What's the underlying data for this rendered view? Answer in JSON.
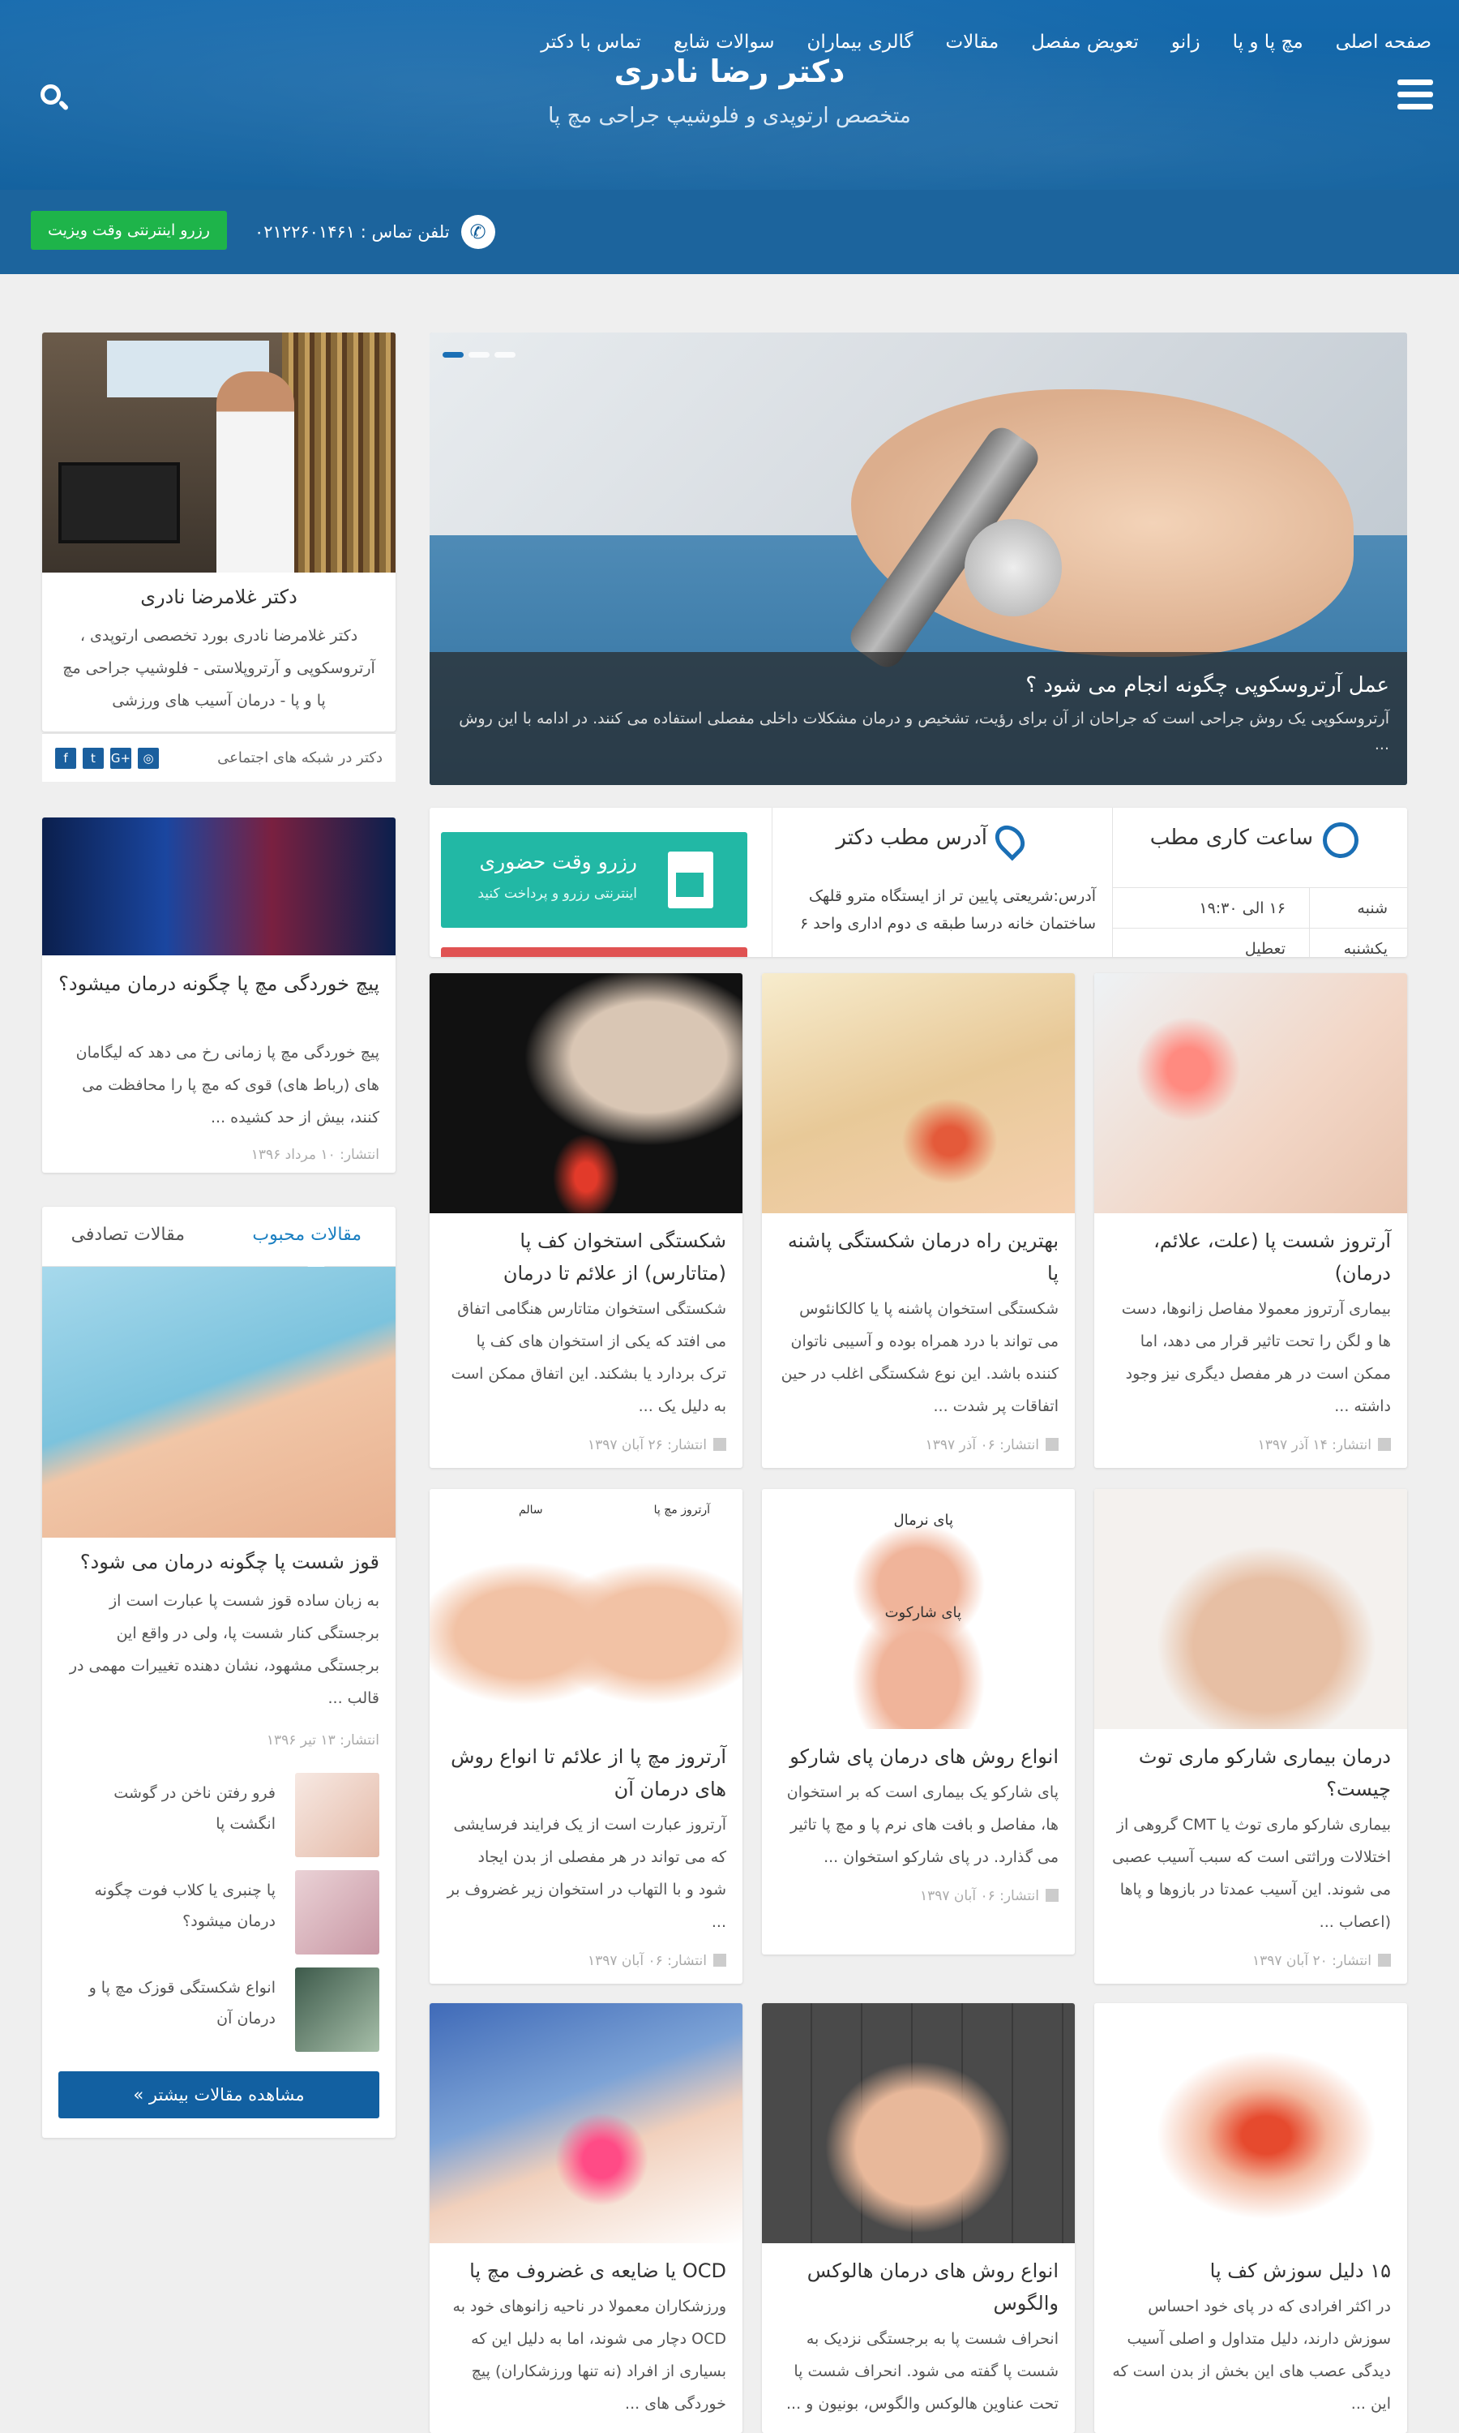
{
  "header": {
    "title": "دکتر رضا نادری",
    "subtitle": "متخصص ارتوپدی و فلوشیپ جراحی مچ پا"
  },
  "nav": {
    "items": [
      "صفحه اصلی",
      "مچ پا و پا",
      "زانو",
      "تعویض مفصل",
      "مقالات",
      "گالری بیماران",
      "سوالات شایع",
      "تماس با دکتر"
    ],
    "phone": "تلفن تماس : ۰۲۱۲۲۶۰۱۴۶۱",
    "book_button": "رزرو اینترنتی وقت ویزیت"
  },
  "slider": {
    "title": "عمل آرتروسکوپی چگونه انجام می شود ؟",
    "text": "آرتروسکوپی یک روش جراحی است که جراحان از آن برای رؤیت، تشخیص  و درمان مشکلات داخلی مفصلی استفاده می کنند. در ادامه با این روش ..."
  },
  "doctor": {
    "name": "دکتر غلامرضا نادری",
    "bio": "دکتر غلامرضا نادری بورد تخصصی ارتوپدی ، آرتروسکوپی و آرتروپلاستی - فلوشیپ جراحی مچ پا و پا - درمان آسیب های ورزشی",
    "social_label": "دکتر در شبکه های اجتماعی",
    "social_icons": [
      "f",
      "t",
      "G+",
      "◎"
    ]
  },
  "info": {
    "hours_title": "ساعت کاری مطب",
    "hours": [
      {
        "day": "شنبه",
        "time": "۱۶ الی ۱۹:۳۰"
      },
      {
        "day": "یکشنبه",
        "time": "تعطیل"
      }
    ],
    "address_title": "آدرس مطب دکتر",
    "address": "آدرس:شریعتی پایین تر از ایستگاه مترو قلهک ساختمان خانه درسا طبقه ی دوم اداری واحد ۶",
    "visit_title": "رزرو وقت حضوری",
    "visit_sub": "اینترنتی رزرو و پرداخت کنید"
  },
  "side_article": {
    "title": "پیچ خوردگی مچ پا چگونه درمان میشود؟",
    "excerpt": "پیچ خوردگی مچ پا زمانی رخ می دهد که لیگامان های (رباط های) قوی که مچ پا را محافظت می کنند، بیش از حد کشیده ...",
    "date": "انتشار: ۱۰ مرداد ۱۳۹۶"
  },
  "tabs_box": {
    "tab_popular": "مقالات محبوب",
    "tab_random": "مقالات تصادفی",
    "featured_title": "قوز شست پا چگونه درمان می شود؟",
    "featured_excerpt": "به زبان ساده قوز شست پا عبارت است از برجستگی کنار شست پا، ولی در واقع این برجستگی مشهود، نشان دهنده تغییرات مهمی در قالب ...",
    "featured_date": "انتشار: ۱۳ تیر ۱۳۹۶",
    "mini": [
      {
        "title": "فرو رفتن ناخن در گوشت انگشت پا"
      },
      {
        "title": "پا چنبری یا کلاب فوت چگونه درمان میشود؟"
      },
      {
        "title": "انواع شکستگی قوزک مچ پا و درمان آن"
      }
    ],
    "more_button": "مشاهده مقالات بیشتر »"
  },
  "articles": [
    {
      "title": "آرتروز شست پا (علت، علائم، درمان)",
      "excerpt": "بیماری آرتروز معمولا مفاصل زانوها، دست ها و لگن را تحت تاثیر قرار می دهد، اما ممکن است در هر مفصل دیگری نیز وجود داشته ...",
      "date": "انتشار: ۱۴ آذر ۱۳۹۷"
    },
    {
      "title": "بهترین راه درمان شکستگی پاشنه پا",
      "excerpt": "شکستگی استخوان پاشنه پا یا کالکانئوس می تواند با درد همراه بوده و آسیبی ناتوان کننده باشد. این نوع شکستگی اغلب در حین اتفاقات پر شدت ...",
      "date": "انتشار: ۰۶ آذر ۱۳۹۷"
    },
    {
      "title": "شکستگی استخوان کف پا (متاتارس) از علائم تا درمان",
      "excerpt": "شکستگی استخوان متاتارس هنگامی اتفاق می افتد که یکی از استخوان های کف پا ترک بردارد یا بشکند. این اتفاق ممکن است به دلیل یک ...",
      "date": "انتشار: ۲۶ آبان ۱۳۹۷"
    },
    {
      "title": "درمان بیماری شارکو ماری توث چیست؟",
      "excerpt": "بیماری شارکو ماری توث یا CMT گروهی از اختلالات وراثتی است که سبب آسیب عصبی می شوند. این آسیب عمدتا در بازوها و پاها (اعصاب ...",
      "date": "انتشار: ۲۰ آبان ۱۳۹۷"
    },
    {
      "title": "انواع روش های درمان پای شارکو",
      "excerpt": "پای شارکو یک بیماری است که بر استخوان ها، مفاصل و بافت های نرم پا و مچ پا تاثیر می گذارد. در پای شارکو استخوان ...",
      "date": "انتشار: ۰۶ آبان ۱۳۹۷",
      "img_label1": "پای نرمال",
      "img_label2": "پای شارکوت"
    },
    {
      "title": "آرتروز مچ پا از علائم تا انواع روش های درمان آن",
      "excerpt": "آرتروز عبارت است از یک فرایند فرسایشی که می تواند در هر مفصلی از بدن ایجاد شود و با التهاب در استخوان زیر غضروف بر ...",
      "date": "انتشار: ۰۶ آبان ۱۳۹۷",
      "img_label1": "آرتروز مچ پا",
      "img_label2": "سالم"
    },
    {
      "title": "۱۵ دلیل سوزش کف پا",
      "excerpt": "در اکثر افرادی که در پای خود احساس سوزش دارند، دلیل متداول و اصلی آسیب دیدگی عصب های این بخش از بدن است که این ..."
    },
    {
      "title": "انواع روش های درمان هالوکس والگوس",
      "excerpt": "انحراف شست پا به برجستگی نزدیک به شست پا گفته می شود. انحراف شست پا تحت عناوین هالوکس والگوس، بونیون و ..."
    },
    {
      "title": "OCD یا ضایعه ی غضروف مچ پا",
      "excerpt": "ورزشکاران معمولا در ناحیه زانوهای خود به OCD دچار می شوند، اما به دلیل این که بسیاری از افراد (نه تنها ورزشکاران) پیچ خوردگی های ..."
    }
  ]
}
